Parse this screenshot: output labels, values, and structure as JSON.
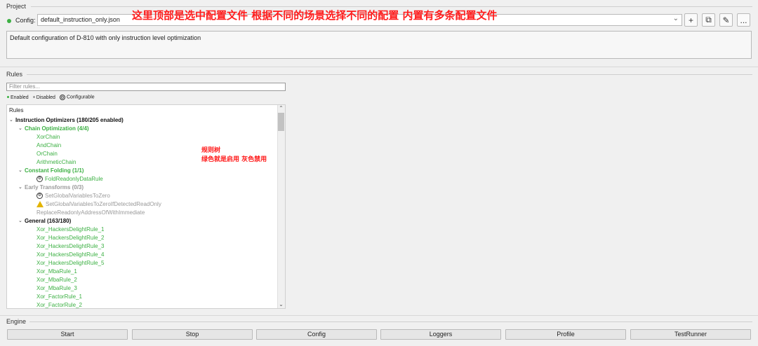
{
  "project": {
    "section_title": "Project",
    "config_label": "Config:",
    "config_value": "default_instruction_only.json",
    "description": "Default configuration of D-810 with only instruction level optimization",
    "buttons": {
      "add": "+",
      "duplicate": "⧉",
      "edit": "✎",
      "more": "..."
    },
    "status_color": "#3cb043"
  },
  "annotation_top": "这里顶部是选中配置文件 根据不同的场景选择不同的配置 内置有多条配置文件",
  "rules": {
    "section_title": "Rules",
    "filter_placeholder": "Filter rules...",
    "legend": {
      "enabled": "Enabled",
      "disabled": "Disabled",
      "configurable": "Configurable"
    },
    "tree_header": "Rules",
    "root": "Instruction Optimizers (180/205 enabled)",
    "groups": [
      {
        "label": "Chain Optimization (4/4)",
        "items": [
          "XorChain",
          "AndChain",
          "OrChain",
          "ArithmeticChain"
        ]
      },
      {
        "label": "Constant Folding (1/1)",
        "items": [
          "FoldReadonlyDataRule"
        ]
      },
      {
        "label": "Early Transforms (0/3)",
        "items": [
          "SetGlobalVariablesToZero",
          "SetGlobalVariablesToZeroIfDetectedReadOnly",
          "ReplaceReadonlyAddressOfWithImmediate"
        ]
      },
      {
        "label": "General (163/180)",
        "items": [
          "Xor_HackersDelightRule_1",
          "Xor_HackersDelightRule_2",
          "Xor_HackersDelightRule_3",
          "Xor_HackersDelightRule_4",
          "Xor_HackersDelightRule_5",
          "Xor_MbaRule_1",
          "Xor_MbaRule_2",
          "Xor_MbaRule_3",
          "Xor_FactorRule_1",
          "Xor_FactorRule_2"
        ]
      }
    ]
  },
  "annotation_tree": {
    "line1": "规则树",
    "line2": "绿色就是启用 灰色禁用"
  },
  "engine": {
    "section_title": "Engine",
    "buttons": [
      "Start",
      "Stop",
      "Config",
      "Loggers",
      "Profile",
      "TestRunner"
    ]
  },
  "colors": {
    "enabled": "#3cb043",
    "disabled": "#9a9a9a",
    "annotation": "#ff1c1c"
  }
}
